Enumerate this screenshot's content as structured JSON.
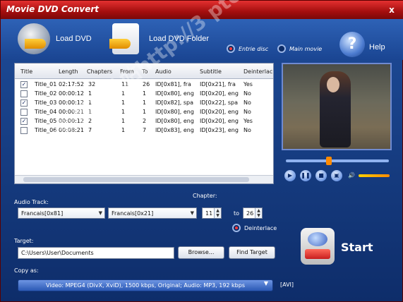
{
  "window": {
    "title": "Movie DVD Convert",
    "close_label": "x"
  },
  "toolbar": {
    "load_dvd": "Load DVD",
    "load_folder": "Load DVD Folder",
    "entire_disc": "Entrie disc",
    "main_movie": "Main movie",
    "help": "Help",
    "help_glyph": "?"
  },
  "table": {
    "headers": [
      "Title",
      "Length",
      "Chapters",
      "From",
      "To",
      "Audio",
      "Subtitle",
      "Deinterlac"
    ],
    "rows": [
      {
        "checked": "✓",
        "title": "Title_01",
        "length": "02:17:52",
        "chapters": "32",
        "from": "11",
        "to": "26",
        "audio": "ID[0x81], fra",
        "subtitle": "ID[0x21], fra",
        "deint": "Yes"
      },
      {
        "checked": "",
        "title": "Title_02",
        "length": "00:00:12",
        "chapters": "1",
        "from": "1",
        "to": "1",
        "audio": "ID[0x80], eng",
        "subtitle": "ID[0x20], eng",
        "deint": "No"
      },
      {
        "checked": "✓",
        "title": "Title_03",
        "length": "00:00:12",
        "chapters": "1",
        "from": "1",
        "to": "1",
        "audio": "ID[0x82], spa",
        "subtitle": "ID[0x22], spa",
        "deint": "No"
      },
      {
        "checked": "",
        "title": "Title_04",
        "length": "00:00:21",
        "chapters": "1",
        "from": "1",
        "to": "1",
        "audio": "ID[0x80], eng",
        "subtitle": "ID[0x20], eng",
        "deint": "No"
      },
      {
        "checked": "✓",
        "title": "Title_05",
        "length": "00:00:12",
        "chapters": "2",
        "from": "1",
        "to": "2",
        "audio": "ID[0x80], eng",
        "subtitle": "ID[0x20], eng",
        "deint": "Yes"
      },
      {
        "checked": "",
        "title": "Title_06",
        "length": "00:08:21",
        "chapters": "7",
        "from": "1",
        "to": "7",
        "audio": "ID[0x83], eng",
        "subtitle": "ID[0x23], eng",
        "deint": "No"
      }
    ]
  },
  "player": {
    "play": "▶",
    "pause": "❚❚",
    "stop": "■",
    "snapshot": "▣",
    "volume": "🔊",
    "seek_fraction": 0.42,
    "volume_fraction": 1.0
  },
  "audio": {
    "label": "Audio Track:",
    "value": "Francais[0x81]"
  },
  "subtitle": {
    "value": "Francais[0x21]"
  },
  "chapter": {
    "label": "Chapter:",
    "from": "11",
    "to_label": "to",
    "to": "26"
  },
  "deinterlace": {
    "label": "Deinterlace"
  },
  "target": {
    "label": "Target:",
    "path": "C:\\Users\\User\\Documents",
    "browse": "Browse...",
    "find": "Find Target"
  },
  "start": {
    "label": "Start"
  },
  "copyas": {
    "label": "Copy as:",
    "value": "Video: MPEG4 (DivX, XviD), 1500 kbps, Original; Audio: MP3, 192 kbps",
    "badge": "[AVI]"
  },
  "watermark": {
    "text": "xyz軟體補給站http://3 pto"
  }
}
